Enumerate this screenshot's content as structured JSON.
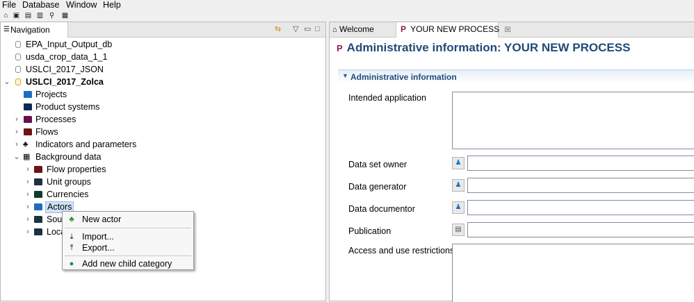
{
  "menu": [
    "File",
    "Database",
    "Window",
    "Help"
  ],
  "toolbar_icons": [
    "home-icon",
    "save-icon",
    "save-as-icon",
    "save-all-icon",
    "network-icon",
    "grid-icon"
  ],
  "navigation": {
    "tab_label": "Navigation",
    "tree": [
      {
        "label": "EPA_Input_Output_db",
        "icon": "database-icon"
      },
      {
        "label": "usda_crop_data_1_1",
        "icon": "database-icon"
      },
      {
        "label": "USLCI_2017_JSON",
        "icon": "database-icon"
      },
      {
        "label": "USLCI_2017_Zolca",
        "icon": "database-icon"
      },
      {
        "label": "Projects",
        "icon": "folder-icon"
      },
      {
        "label": "Product systems",
        "icon": "folder-icon"
      },
      {
        "label": "Processes",
        "icon": "folder-icon"
      },
      {
        "label": "Flows",
        "icon": "folder-icon"
      },
      {
        "label": "Indicators and parameters",
        "icon": "indicators-icon"
      },
      {
        "label": "Background data",
        "icon": "grid-icon"
      },
      {
        "label": "Flow properties",
        "icon": "folder-icon"
      },
      {
        "label": "Unit groups",
        "icon": "folder-icon"
      },
      {
        "label": "Currencies",
        "icon": "folder-icon"
      },
      {
        "label": "Actors",
        "icon": "folder-icon"
      },
      {
        "label": "Sour",
        "icon": "folder-icon"
      },
      {
        "label": "Loca",
        "icon": "folder-icon"
      }
    ]
  },
  "context_menu": {
    "items": [
      "New actor",
      "Import...",
      "Export...",
      "Add new child category"
    ]
  },
  "editor": {
    "tabs": {
      "welcome": "Welcome",
      "process": "YOUR NEW PROCESS",
      "process_prefix": "P",
      "close": "☒"
    },
    "title_prefix": "P",
    "title": "Administrative information: YOUR NEW PROCESS",
    "section": "Administrative information",
    "fields": {
      "intended_application": "Intended application",
      "data_set_owner": "Data set owner",
      "data_generator": "Data generator",
      "data_documentor": "Data documentor",
      "publication": "Publication",
      "access_restrictions": "Access and use restrictions"
    }
  }
}
